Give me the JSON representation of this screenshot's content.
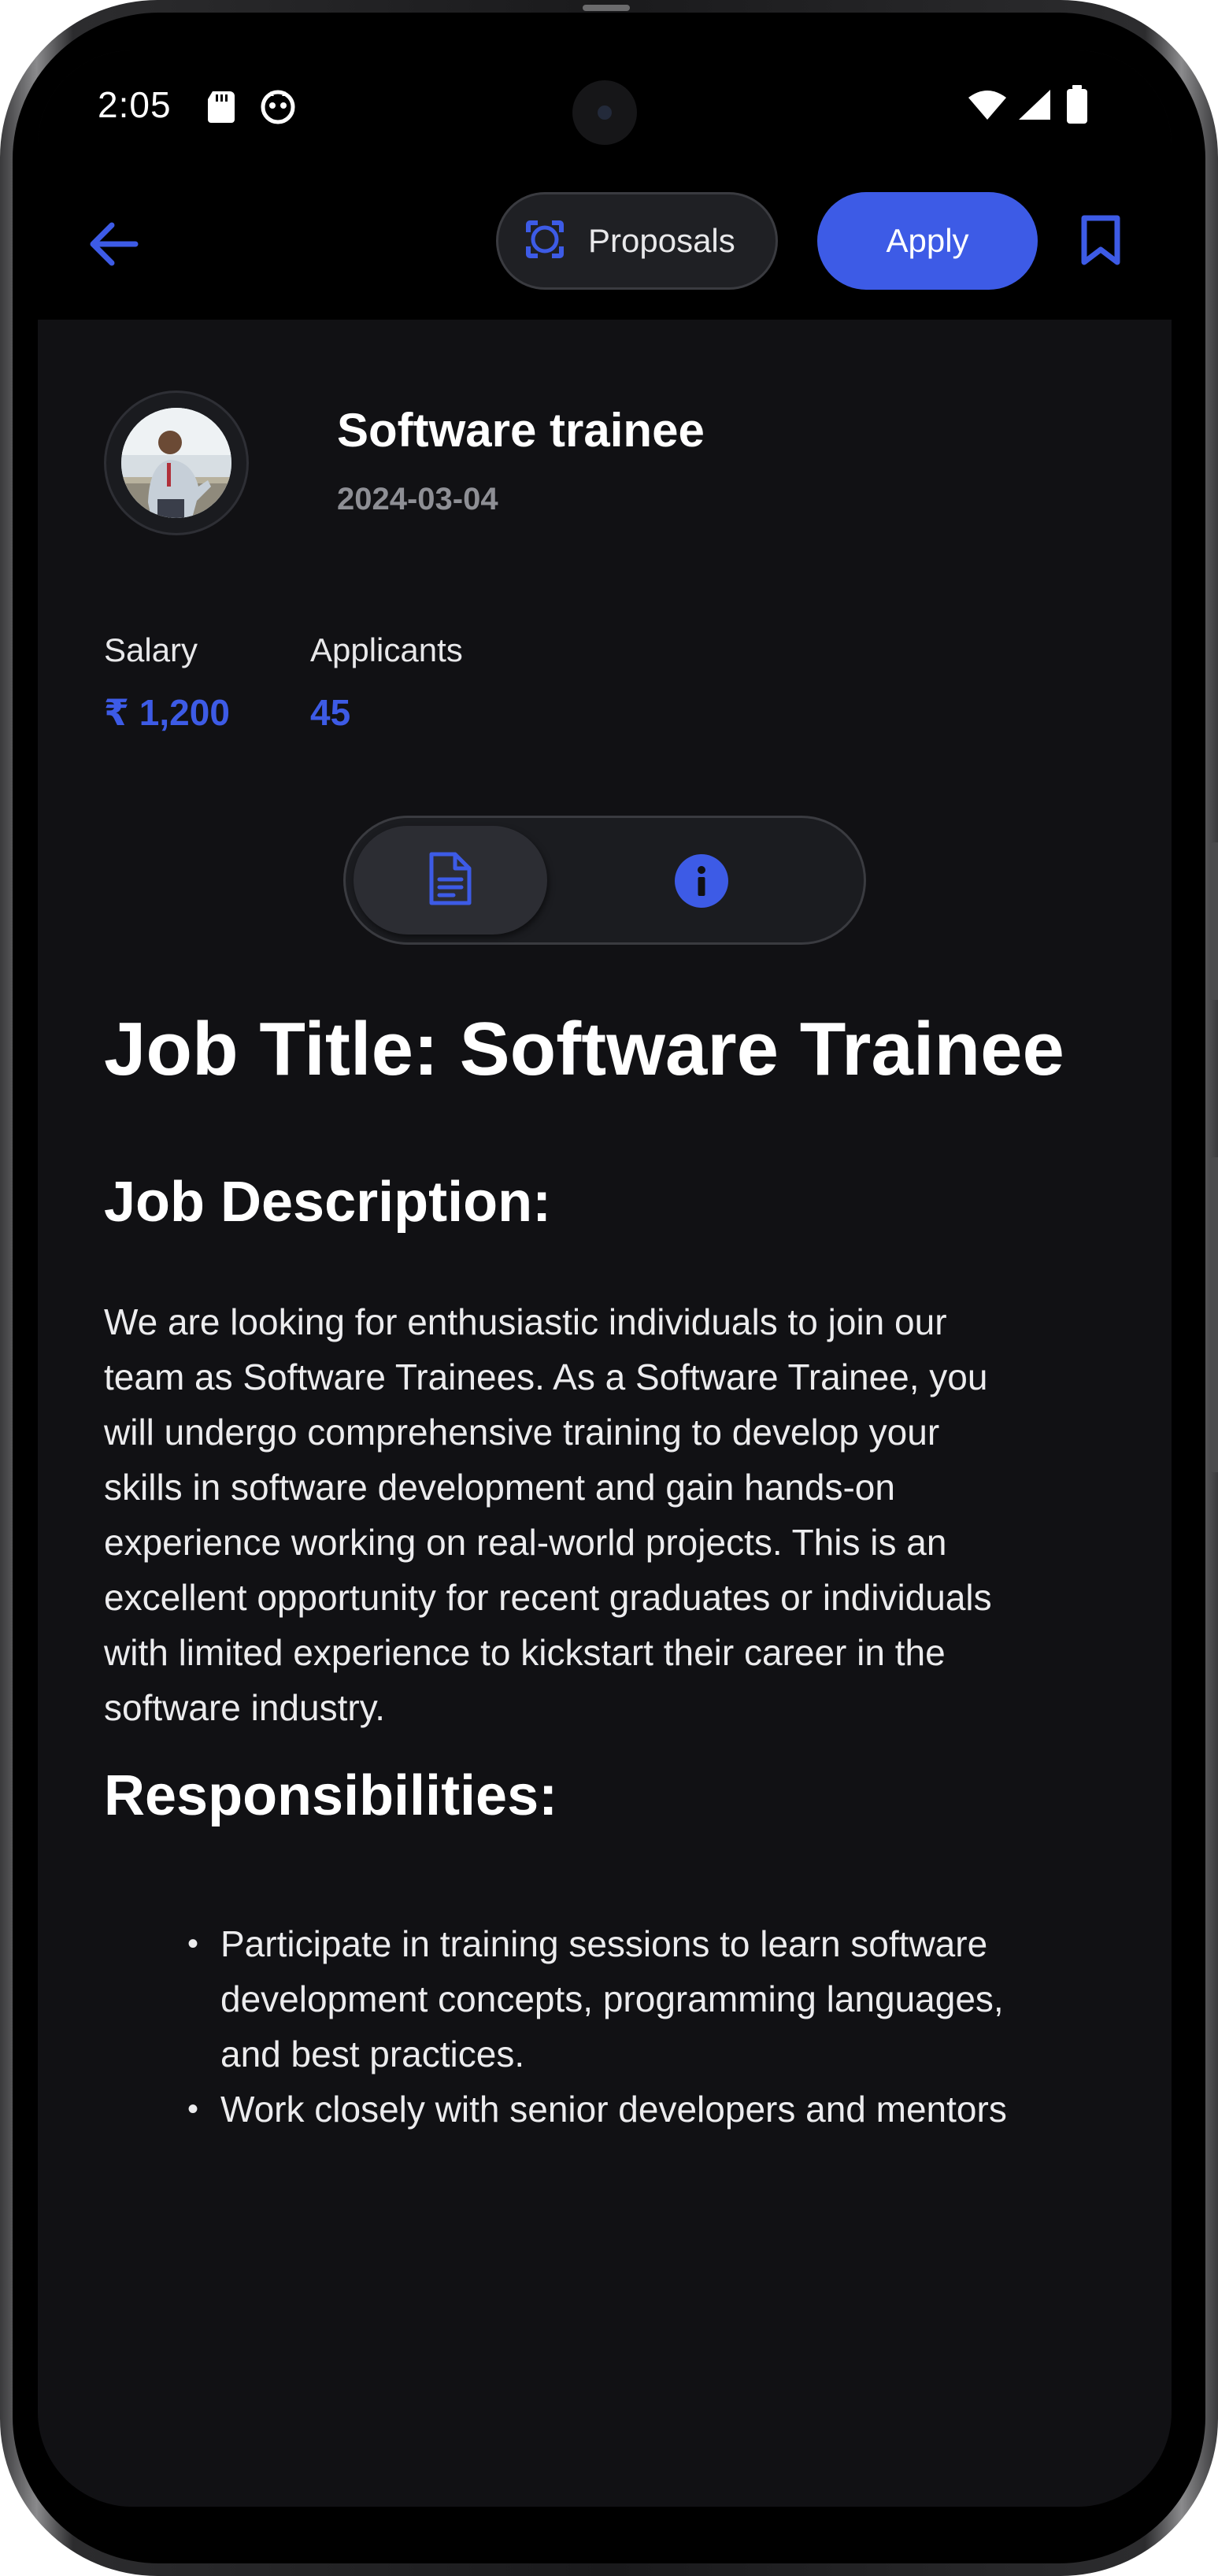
{
  "status_bar": {
    "time": "2:05"
  },
  "app_bar": {
    "proposals_label": "Proposals",
    "apply_label": "Apply"
  },
  "job": {
    "title": "Software trainee",
    "date": "2024-03-04",
    "salary_label": "Salary",
    "salary_value": "₹ 1,200",
    "applicants_label": "Applicants",
    "applicants_value": "45"
  },
  "tabs": [
    "document",
    "info"
  ],
  "content": {
    "heading": "Job Title: Software Trainee",
    "description_heading": "Job Description:",
    "description_lines": [
      "We are looking for enthusiastic individuals to join our",
      "team as Software Trainees. As a Software Trainee, you",
      "will undergo comprehensive training to develop your",
      "skills in software development and gain hands-on",
      "experience working on real-world projects. This is an",
      "excellent opportunity for recent graduates or individuals",
      "with limited experience to kickstart their career in the",
      "software industry."
    ],
    "responsibilities_heading": "Responsibilities:",
    "responsibilities": [
      {
        "lines": [
          "Participate in training sessions to learn software",
          "development concepts, programming languages,",
          "and best practices."
        ]
      },
      {
        "lines": [
          "Work closely with senior developers and mentors"
        ]
      }
    ]
  },
  "colors": {
    "accent": "#3d5be6",
    "background": "#111114",
    "muted_text": "#8e8f95"
  },
  "icons": {
    "back": "arrow-left-icon",
    "proposals": "scan-frame-icon",
    "bookmark": "bookmark-icon",
    "document": "document-icon",
    "info": "info-icon"
  }
}
